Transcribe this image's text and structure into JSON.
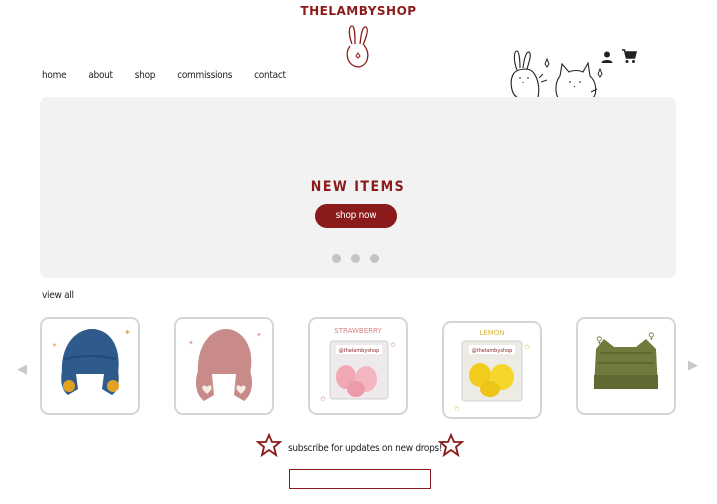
{
  "brand": {
    "name": "THELAMBYSHOP",
    "color": "#8b1a1a"
  },
  "nav": {
    "items": [
      {
        "label": "home"
      },
      {
        "label": "about"
      },
      {
        "label": "shop"
      },
      {
        "label": "commissions"
      },
      {
        "label": "contact"
      }
    ]
  },
  "header_icons": [
    "account-icon",
    "cart-icon"
  ],
  "banner": {
    "title": "NEW ITEMS",
    "button_label": "shop now",
    "slides": 3
  },
  "products": {
    "view_all_label": "view all",
    "items": [
      {
        "name": "blue-hat-with-flower-earflaps",
        "label": ""
      },
      {
        "name": "pink-hat-with-heart-earflaps",
        "label": ""
      },
      {
        "name": "strawberry-pouch",
        "label": "STRAWBERRY",
        "tag": "@thelambyshop"
      },
      {
        "name": "lemon-pouch",
        "label": "LEMON",
        "tag": "@thelambyshop"
      },
      {
        "name": "green-beanie",
        "label": ""
      }
    ]
  },
  "subscribe": {
    "text": "subscribe for updates on new drops!",
    "input_value": "",
    "input_placeholder": ""
  },
  "colors": {
    "accent": "#8b1a1a",
    "banner_bg": "#f2f2f2",
    "card_border": "#d6d6d6"
  }
}
